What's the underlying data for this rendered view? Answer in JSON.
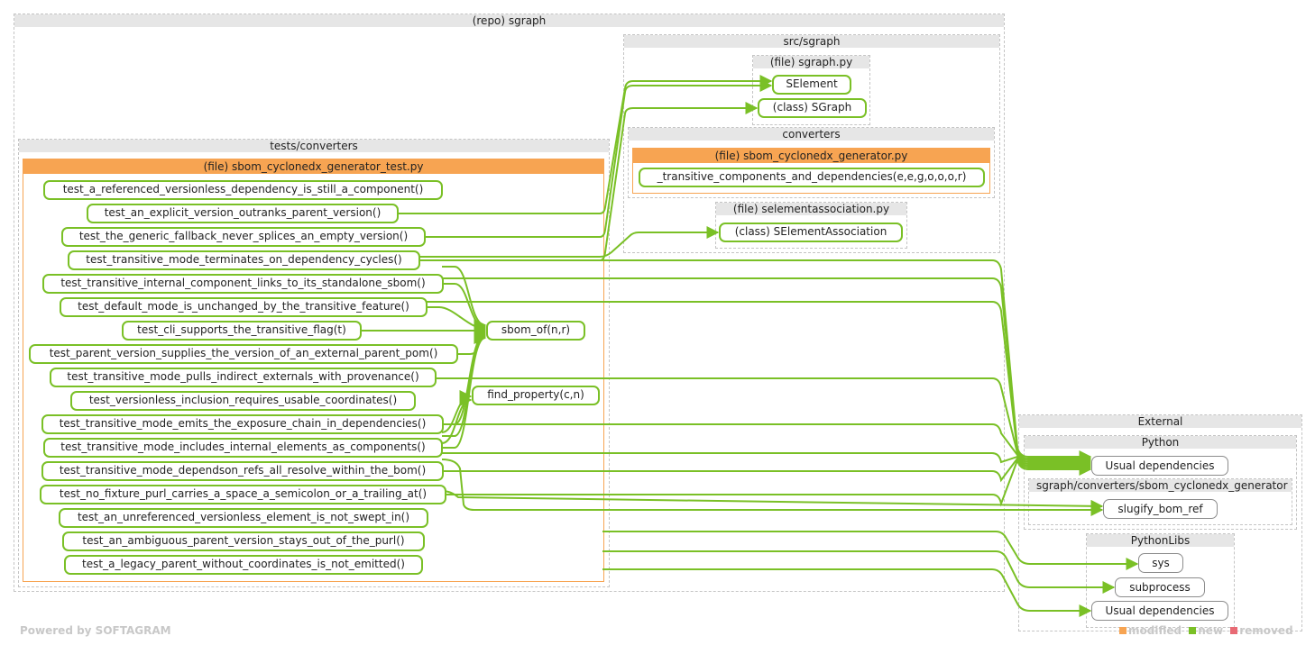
{
  "containers": {
    "repo": "(repo) sgraph",
    "src_sgraph": "src/sgraph",
    "sgraph_py": "(file) sgraph.py",
    "converters": "converters",
    "generator_py": "(file) sbom_cyclonedx_generator.py",
    "selementassociation_py": "(file) selementassociation.py",
    "tests_converters": "tests/converters",
    "test_file": "(file) sbom_cyclonedx_generator_test.py",
    "external": "External",
    "python": "Python",
    "ext_generator": "sgraph/converters/sbom_cyclonedx_generator",
    "pythonlibs": "PythonLibs"
  },
  "nodes": {
    "selement": "SElement",
    "sgraph_class": "(class) SGraph",
    "transitive": "_transitive_components_and_dependencies(e,e,g,o,o,o,r)",
    "selementassociation": "(class) SElementAssociation",
    "sbom_of": "sbom_of(n,r)",
    "find_property": "find_property(c,n)"
  },
  "tests": [
    "test_a_referenced_versionless_dependency_is_still_a_component()",
    "test_an_explicit_version_outranks_parent_version()",
    "test_the_generic_fallback_never_splices_an_empty_version()",
    "test_transitive_mode_terminates_on_dependency_cycles()",
    "test_transitive_internal_component_links_to_its_standalone_sbom()",
    "test_default_mode_is_unchanged_by_the_transitive_feature()",
    "test_cli_supports_the_transitive_flag(t)",
    "test_parent_version_supplies_the_version_of_an_external_parent_pom()",
    "test_transitive_mode_pulls_indirect_externals_with_provenance()",
    "test_versionless_inclusion_requires_usable_coordinates()",
    "test_transitive_mode_emits_the_exposure_chain_in_dependencies()",
    "test_transitive_mode_includes_internal_elements_as_components()",
    "test_transitive_mode_dependson_refs_all_resolve_within_the_bom()",
    "test_no_fixture_purl_carries_a_space_a_semicolon_or_a_trailing_at()",
    "test_an_unreferenced_versionless_element_is_not_swept_in()",
    "test_an_ambiguous_parent_version_stays_out_of_the_purl()",
    "test_a_legacy_parent_without_coordinates_is_not_emitted()"
  ],
  "external_nodes": {
    "python_usual": "Usual dependencies",
    "slugify": "slugify_bom_ref",
    "sys": "sys",
    "subprocess": "subprocess",
    "libs_usual": "Usual dependencies"
  },
  "footer": "Powered by SOFTAGRAM",
  "legend": {
    "modified": "modified",
    "new": "new",
    "removed": "removed"
  },
  "colors": {
    "modified": "#f7a452",
    "new": "#7ac026",
    "removed": "#e86a74",
    "container_header": "#e6e6e6"
  }
}
